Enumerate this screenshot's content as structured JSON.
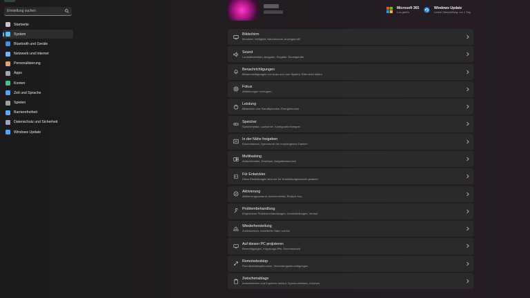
{
  "search": {
    "placeholder": "Einstellung suchen"
  },
  "sidebar": {
    "items": [
      {
        "label": "Startseite",
        "icon": "home-icon",
        "color": "#c8c8c8",
        "active": false
      },
      {
        "label": "System",
        "icon": "monitor-icon",
        "color": "#4cc2ff",
        "active": true
      },
      {
        "label": "Bluetooth und Geräte",
        "icon": "bluetooth-icon",
        "color": "#3a8ff0",
        "active": false
      },
      {
        "label": "Netzwerk und Internet",
        "icon": "wifi-icon",
        "color": "#6fb4ff",
        "active": false
      },
      {
        "label": "Personalisierung",
        "icon": "brush-icon",
        "color": "#e8a070",
        "active": false
      },
      {
        "label": "Apps",
        "icon": "apps-icon",
        "color": "#9aa7b5",
        "active": false
      },
      {
        "label": "Konten",
        "icon": "user-icon",
        "color": "#3ec58a",
        "active": false
      },
      {
        "label": "Zeit und Sprache",
        "icon": "globe-clock-icon",
        "color": "#4aa6ff",
        "active": false
      },
      {
        "label": "Spielen",
        "icon": "gamepad-icon",
        "color": "#a0a0a0",
        "active": false
      },
      {
        "label": "Barrierefreiheit",
        "icon": "accessibility-icon",
        "color": "#5fa8ff",
        "active": false
      },
      {
        "label": "Datenschutz und Sicherheit",
        "icon": "shield-icon",
        "color": "#9ea7b0",
        "active": false
      },
      {
        "label": "Windows Update",
        "icon": "update-icon",
        "color": "#4aa6ff",
        "active": false
      }
    ]
  },
  "widgets": {
    "m365": {
      "title": "Microsoft 365",
      "sub": "Los geht's",
      "icon": "microsoft-logo-icon"
    },
    "update": {
      "title": "Windows Update",
      "sub": "Letzte Überprüfung: vor 1 Tag",
      "icon": "update-icon"
    }
  },
  "settings": [
    {
      "title": "Bildschirm",
      "desc": "Monitore, Helligkeit, Nachtmodus, Anzeigeprofil",
      "icon": "monitor-icon"
    },
    {
      "title": "Sound",
      "desc": "Lautstärkestufen, Ausgabe, Eingabe, Soundgeräte",
      "icon": "speaker-icon"
    },
    {
      "title": "Benachrichtigungen",
      "desc": "Benachrichtigungen von Apps und vom System, Bitte nicht stören",
      "icon": "bell-icon"
    },
    {
      "title": "Fokus",
      "desc": "Ablenkungen verringern",
      "icon": "focus-icon"
    },
    {
      "title": "Leistung",
      "desc": "Bildschirm und Standbymodus, Energiemodus",
      "icon": "power-icon"
    },
    {
      "title": "Speicher",
      "desc": "Speicherplatz, Laufwerke, Konfigurationsregeln",
      "icon": "storage-icon"
    },
    {
      "title": "In der Nähe freigeben",
      "desc": "Erkennbarkeit, Speicherort der empfangenen Dateien",
      "icon": "share-icon"
    },
    {
      "title": "Multitasking",
      "desc": "Andockfenster, Desktops, Aufgabenwechsel",
      "icon": "multitasking-icon"
    },
    {
      "title": "Für Entwickler",
      "desc": "Diese Einstellungen sind nur für Entwicklungszwecke gedacht",
      "icon": "developer-icon"
    },
    {
      "title": "Aktivierung",
      "desc": "Aktivierungszustand, Abonnements, Product Key",
      "icon": "check-circle-icon"
    },
    {
      "title": "Problembehandlung",
      "desc": "Empfohlene Problembehandlungen, Voreinstellungen, Verlauf",
      "icon": "wrench-icon"
    },
    {
      "title": "Wiederherstellung",
      "desc": "Zurücksetzen, erweiterter Start, zurück",
      "icon": "recovery-icon"
    },
    {
      "title": "Auf diesen PC projizieren",
      "desc": "Berechtigungen, Kopplungs-PIN, Erkennbarkeit",
      "icon": "project-icon"
    },
    {
      "title": "Remotedesktop",
      "desc": "Remotedesktopbenutzer, Verbindungsberechtigungen",
      "icon": "remote-desktop-icon"
    },
    {
      "title": "Zwischenablage",
      "desc": "Ausschneiden und Kopieren-Verlauf, Synchronisieren, Löschen",
      "icon": "clipboard-icon"
    }
  ]
}
